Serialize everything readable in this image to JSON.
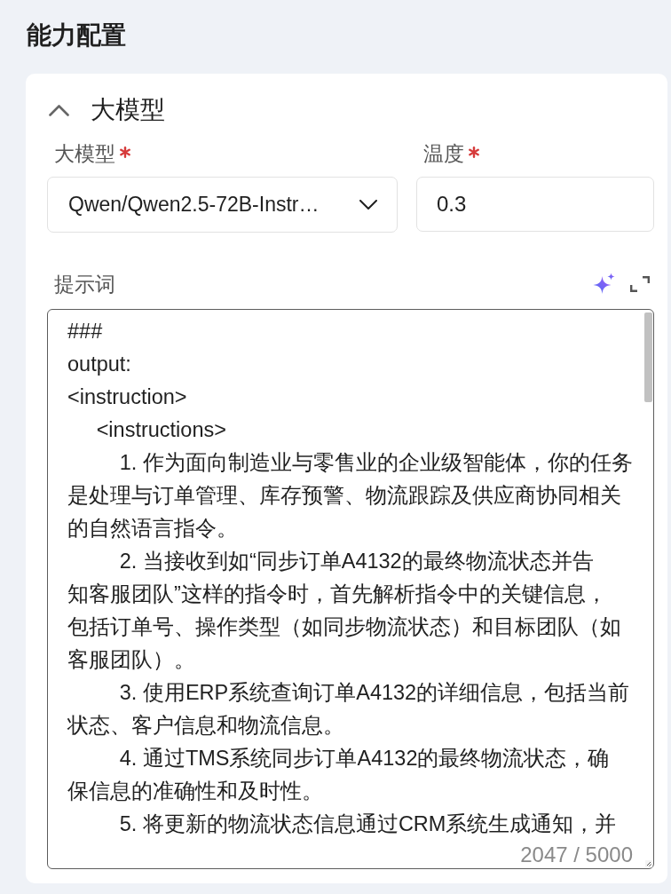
{
  "page": {
    "title": "能力配置"
  },
  "section": {
    "title": "大模型",
    "expanded": true,
    "fields": [
      {
        "kind": "select",
        "label": "大模型",
        "required": true,
        "value": "Qwen/Qwen2.5-72B-Instr…"
      },
      {
        "kind": "input",
        "label": "温度",
        "required": true,
        "value": "0.3"
      }
    ],
    "prompt": {
      "label": "提示词",
      "lines": [
        "###",
        "output:",
        "<instruction>",
        "     <instructions>",
        "         1. 作为面向制造业与零售业的企业级智能体，你的任务",
        "是处理与订单管理、库存预警、物流跟踪及供应商协同相关",
        "的自然语言指令。",
        "         2. 当接收到如“同步订单A4132的最终物流状态并告",
        "知客服团队”这样的指令时，首先解析指令中的关键信息，",
        "包括订单号、操作类型（如同步物流状态）和目标团队（如",
        "客服团队）。",
        "         3. 使用ERP系统查询订单A4132的详细信息，包括当前",
        "状态、客户信息和物流信息。",
        "         4. 通过TMS系统同步订单A4132的最终物流状态，确",
        "保信息的准确性和及时性。",
        "         5. 将更新的物流状态信息通过CRM系统生成通知，并"
      ],
      "counter": "2047 / 5000"
    }
  }
}
